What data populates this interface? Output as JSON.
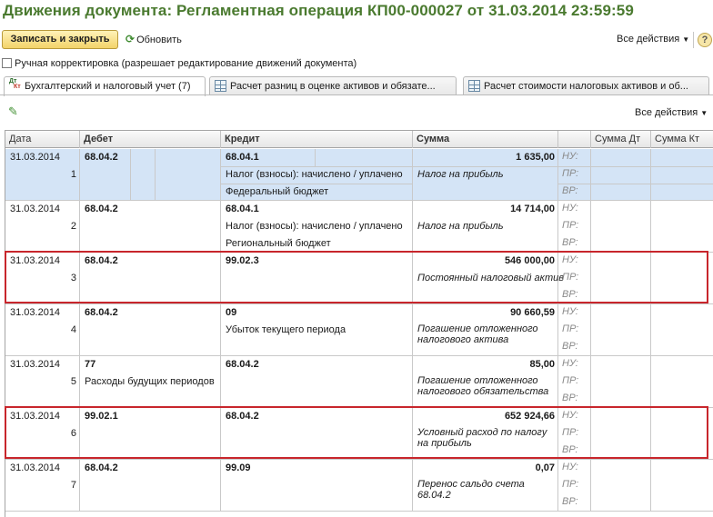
{
  "title": "Движения документа: Регламентная операция КП00-000027 от 31.03.2014 23:59:59",
  "toolbar": {
    "save_close": "Записать и закрыть",
    "refresh": "Обновить",
    "all_actions": "Все действия",
    "help": "?"
  },
  "manual_correction": {
    "label": "Ручная корректировка (разрешает редактирование движений документа)",
    "checked": false
  },
  "tabs": [
    {
      "label": "Бухгалтерский и налоговый учет (7)",
      "active": true,
      "icon": "dt-kt-icon"
    },
    {
      "label": "Расчет разниц в оценке активов и обязате...",
      "active": false,
      "icon": "table-icon"
    },
    {
      "label": "Расчет стоимости налоговых активов и об...",
      "active": false,
      "icon": "table-icon"
    }
  ],
  "subtoolbar": {
    "all_actions": "Все действия",
    "edit_icon": "pencil-icon"
  },
  "table": {
    "headers": {
      "date": "Дата",
      "debit": "Дебет",
      "credit": "Кредит",
      "amount": "Сумма",
      "sum_dt": "Сумма Дт",
      "sum_kt": "Сумма Кт"
    },
    "tag_labels": [
      "НУ:",
      "ПР:",
      "ВР:"
    ],
    "rows": [
      {
        "date": "31.03.2014",
        "num": "1",
        "debit": "68.04.2",
        "debit_sub1": "",
        "debit_sub2": "",
        "credit": "68.04.1",
        "credit_sub1": "Налог (взносы): начислено / уплачено",
        "credit_sub2": "Федеральный бюджет",
        "amount": "1 635,00",
        "content": "Налог на прибыль",
        "selected": true
      },
      {
        "date": "31.03.2014",
        "num": "2",
        "debit": "68.04.2",
        "debit_sub1": "",
        "debit_sub2": "",
        "credit": "68.04.1",
        "credit_sub1": "Налог (взносы): начислено / уплачено",
        "credit_sub2": "Региональный бюджет",
        "amount": "14 714,00",
        "content": "Налог на прибыль",
        "selected": false
      },
      {
        "date": "31.03.2014",
        "num": "3",
        "debit": "68.04.2",
        "debit_sub1": "",
        "debit_sub2": "",
        "credit": "99.02.3",
        "credit_sub1": "",
        "credit_sub2": "",
        "amount": "546 000,00",
        "content": "Постоянный налоговый актив",
        "selected": false,
        "highlight": true
      },
      {
        "date": "31.03.2014",
        "num": "4",
        "debit": "68.04.2",
        "debit_sub1": "",
        "debit_sub2": "",
        "credit": "09",
        "credit_sub1": "Убыток текущего периода",
        "credit_sub2": "",
        "amount": "90 660,59",
        "content": "Погашение отложенного налогового актива",
        "selected": false
      },
      {
        "date": "31.03.2014",
        "num": "5",
        "debit": "77",
        "debit_sub1": "Расходы будущих периодов",
        "debit_sub2": "",
        "credit": "68.04.2",
        "credit_sub1": "",
        "credit_sub2": "",
        "amount": "85,00",
        "content": "Погашение отложенного налогового обязательства",
        "selected": false
      },
      {
        "date": "31.03.2014",
        "num": "6",
        "debit": "99.02.1",
        "debit_sub1": "",
        "debit_sub2": "",
        "credit": "68.04.2",
        "credit_sub1": "",
        "credit_sub2": "",
        "amount": "652 924,66",
        "content": "Условный расход по налогу на прибыль",
        "selected": false,
        "highlight": true
      },
      {
        "date": "31.03.2014",
        "num": "7",
        "debit": "68.04.2",
        "debit_sub1": "",
        "debit_sub2": "",
        "credit": "99.09",
        "credit_sub1": "",
        "credit_sub2": "",
        "amount": "0,07",
        "content": "Перенос сальдо счета 68.04.2",
        "selected": false
      }
    ]
  },
  "colors": {
    "title": "#4a7a2f",
    "selected_row": "#d4e4f6",
    "highlight_border": "#c8262c",
    "save_button": "#f3d36a"
  }
}
